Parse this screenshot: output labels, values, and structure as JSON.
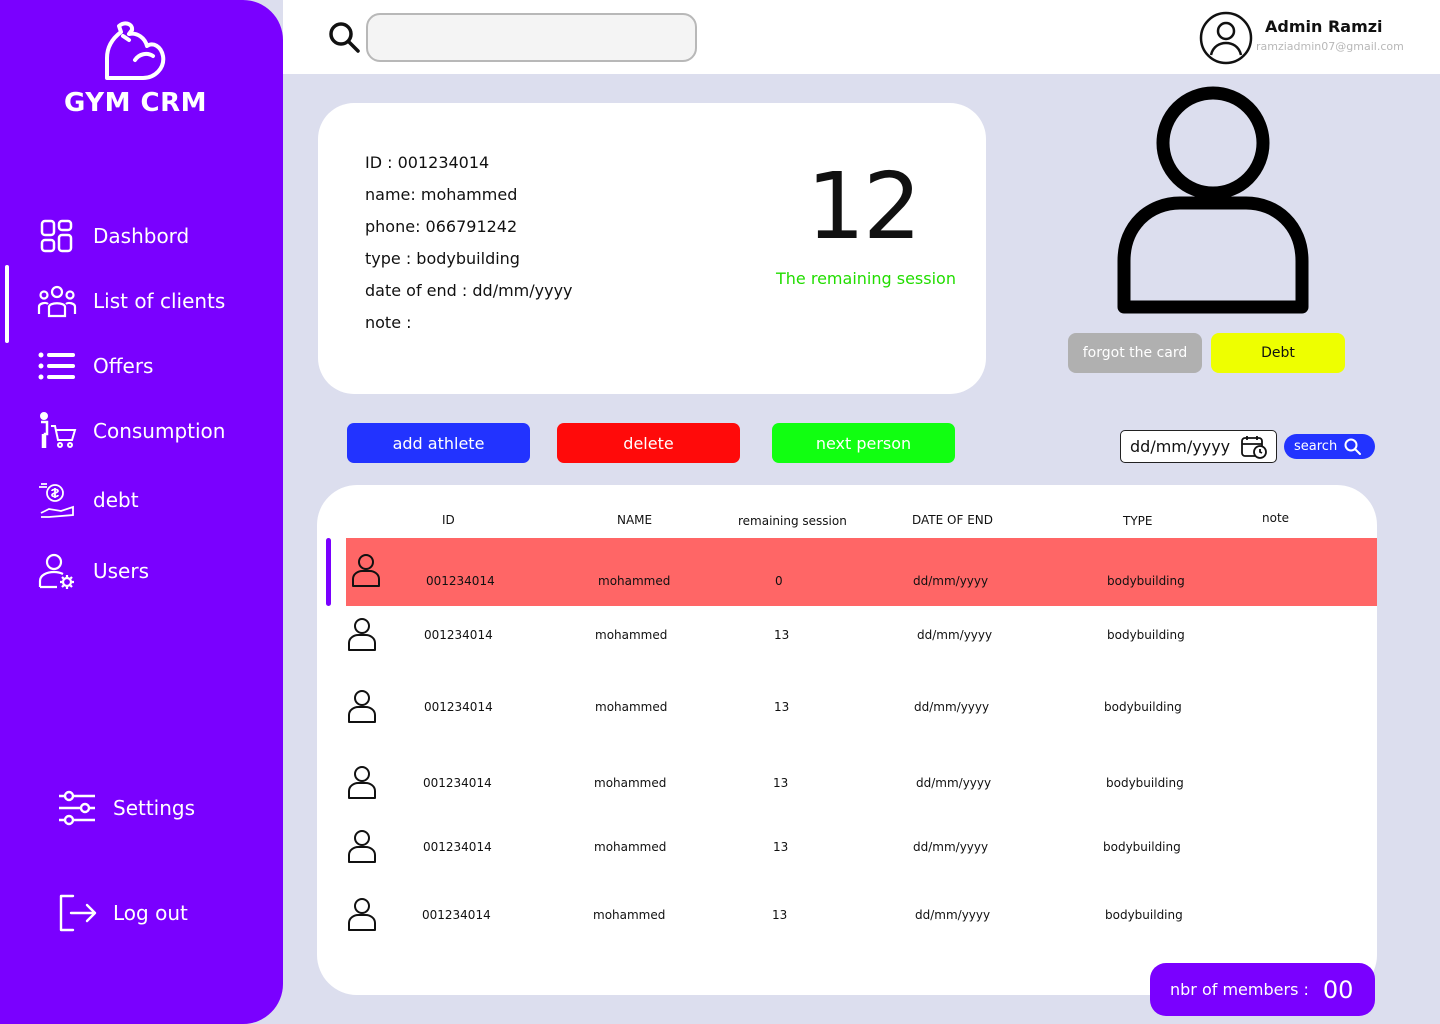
{
  "app": {
    "title": "GYM CRM"
  },
  "sidebar": {
    "items": [
      {
        "label": "Dashbord",
        "icon": "grid-icon"
      },
      {
        "label": "List of clients",
        "icon": "group-icon"
      },
      {
        "label": "Offers",
        "icon": "list-icon"
      },
      {
        "label": "Consumption",
        "icon": "cart-icon"
      },
      {
        "label": "debt",
        "icon": "money-hand-icon"
      },
      {
        "label": "Users",
        "icon": "user-settings-icon"
      }
    ],
    "settings": "Settings",
    "logout": "Log out"
  },
  "topbar": {
    "search_placeholder": "",
    "admin_name": "Admin Ramzi",
    "admin_email": "ramziadmin07@gmail.com"
  },
  "info": {
    "id": "ID : 001234014",
    "name": "name: mohammed",
    "phone": "phone: 066791242",
    "type": "type : bodybuilding",
    "date_end": "date of end : dd/mm/yyyy",
    "note": "note :",
    "remaining_value": "12",
    "remaining_label": "The remaining session"
  },
  "card_actions": {
    "forgot": "forgot the card",
    "debt": "Debt"
  },
  "actions": {
    "add": "add athlete",
    "delete": "delete",
    "next": "next person"
  },
  "filter": {
    "date": "dd/mm/yyyy",
    "search": "search"
  },
  "table": {
    "headers": [
      "ID",
      "NAME",
      "remaining session",
      "DATE OF END",
      "TYPE",
      "note"
    ],
    "rows": [
      {
        "id": "001234014",
        "name": "mohammed",
        "remaining": "0",
        "date": "dd/mm/yyyy",
        "type": "bodybuilding",
        "note": ""
      },
      {
        "id": "001234014",
        "name": "mohammed",
        "remaining": "13",
        "date": "dd/mm/yyyy",
        "type": "bodybuilding",
        "note": ""
      },
      {
        "id": "001234014",
        "name": "mohammed",
        "remaining": "13",
        "date": "dd/mm/yyyy",
        "type": "bodybuilding",
        "note": ""
      },
      {
        "id": "001234014",
        "name": "mohammed",
        "remaining": "13",
        "date": "dd/mm/yyyy",
        "type": "bodybuilding",
        "note": ""
      },
      {
        "id": "001234014",
        "name": "mohammed",
        "remaining": "13",
        "date": "dd/mm/yyyy",
        "type": "bodybuilding",
        "note": ""
      },
      {
        "id": "001234014",
        "name": "mohammed",
        "remaining": "13",
        "date": "dd/mm/yyyy",
        "type": "bodybuilding",
        "note": ""
      }
    ]
  },
  "members": {
    "label": "nbr of members :",
    "value": "00"
  },
  "colors": {
    "brand": "#7a00ff",
    "selected_row": "#ff6666",
    "remaining_text": "#22dd00",
    "add": "#2233ff",
    "delete": "#ff0a0a",
    "next": "#11ff11",
    "debt": "#eeff00"
  }
}
